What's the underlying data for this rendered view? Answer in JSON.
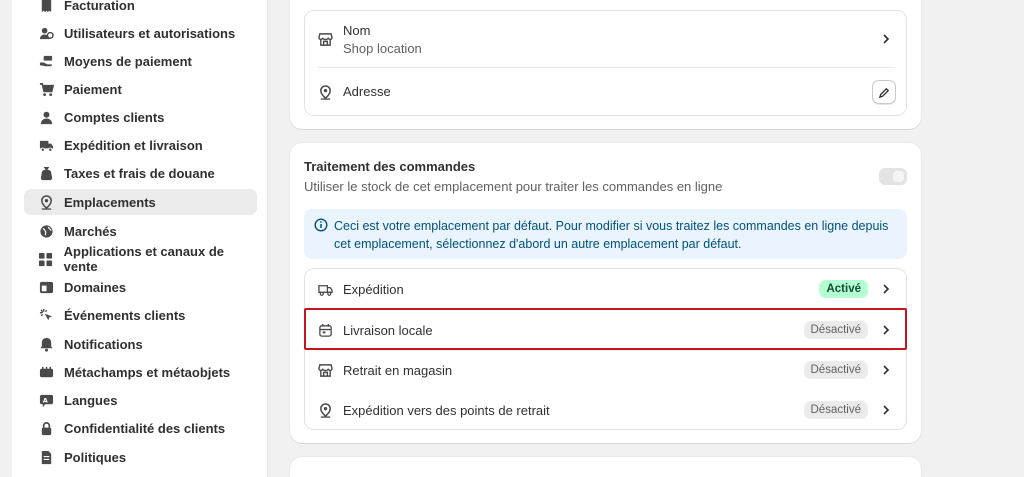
{
  "sidebar": {
    "items": [
      {
        "label": "Facturation",
        "icon": "receipt-icon"
      },
      {
        "label": "Utilisateurs et autorisations",
        "icon": "users-icon"
      },
      {
        "label": "Moyens de paiement",
        "icon": "hand-money-icon"
      },
      {
        "label": "Paiement",
        "icon": "cart-icon"
      },
      {
        "label": "Comptes clients",
        "icon": "person-icon"
      },
      {
        "label": "Expédition et livraison",
        "icon": "truck-icon"
      },
      {
        "label": "Taxes et frais de douane",
        "icon": "tax-bag-icon"
      },
      {
        "label": "Emplacements",
        "icon": "location-pin-icon",
        "active": true
      },
      {
        "label": "Marchés",
        "icon": "globe-icon"
      },
      {
        "label": "Applications et canaux de vente",
        "icon": "apps-icon"
      },
      {
        "label": "Domaines",
        "icon": "domain-icon"
      },
      {
        "label": "Événements clients",
        "icon": "cursor-click-icon"
      },
      {
        "label": "Notifications",
        "icon": "bell-icon"
      },
      {
        "label": "Métachamps et métaobjets",
        "icon": "metafields-icon"
      },
      {
        "label": "Langues",
        "icon": "language-icon"
      },
      {
        "label": "Confidentialité des clients",
        "icon": "lock-icon"
      },
      {
        "label": "Politiques",
        "icon": "document-icon"
      }
    ]
  },
  "location_card": {
    "name_label": "Nom",
    "name_value": "Shop location",
    "address_label": "Adresse"
  },
  "fulfillment": {
    "title": "Traitement des commandes",
    "subtitle": "Utiliser le stock de cet emplacement pour traiter les commandes en ligne",
    "banner_text": "Ceci est votre emplacement par défaut. Pour modifier si vous traitez les commandes en ligne depuis cet emplacement, sélectionnez d'abord un autre emplacement par défaut.",
    "rows": [
      {
        "label": "Expédition",
        "status": "Activé",
        "icon": "truck-icon"
      },
      {
        "label": "Livraison locale",
        "status": "Désactivé",
        "icon": "calendar-icon"
      },
      {
        "label": "Retrait en magasin",
        "status": "Désactivé",
        "icon": "store-icon"
      },
      {
        "label": "Expédition vers des points de retrait",
        "status": "Désactivé",
        "icon": "location-pin-icon"
      }
    ]
  },
  "colors": {
    "active_badge": "#b4fed2",
    "inactive_badge": "#ebebeb",
    "highlight_border": "#c4161c",
    "banner_bg": "#eaf4ff"
  }
}
